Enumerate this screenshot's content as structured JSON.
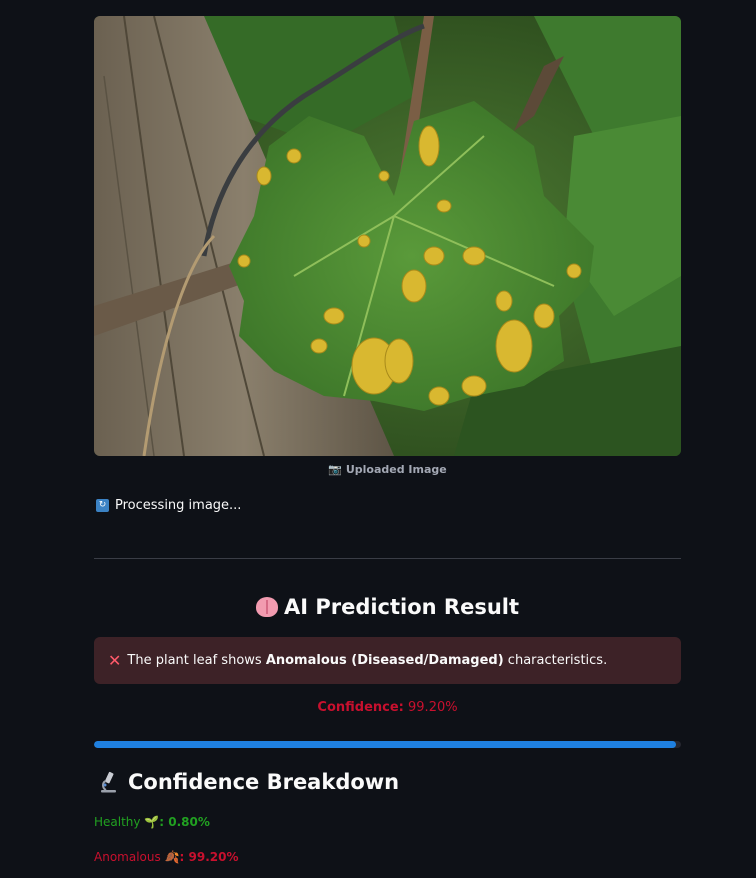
{
  "image": {
    "caption_icon": "camera-icon",
    "caption": "Uploaded Image"
  },
  "status": {
    "icon": "refresh-icon",
    "text": "Processing image..."
  },
  "result": {
    "heading_icon": "brain-icon",
    "heading": "AI Prediction Result",
    "alert_icon": "cross-mark-icon",
    "alert_prefix": "The plant leaf shows ",
    "alert_bold": "Anomalous (Diseased/Damaged)",
    "alert_suffix": " characteristics.",
    "alert_color": "#3d2227",
    "confidence_label": "Confidence:",
    "confidence_value": "99.20%",
    "progress_fraction": 0.992,
    "accent_color": "#1f80e0",
    "danger_color": "#c8102e"
  },
  "breakdown": {
    "heading_icon": "microscope-icon",
    "heading": "Confidence Breakdown",
    "healthy_label": "Healthy",
    "healthy_icon": "seedling-icon",
    "healthy_value": ": 0.80%",
    "healthy_color": "#21a121",
    "anomalous_label": "Anomalous",
    "anomalous_icon": "fallen-leaf-icon",
    "anomalous_value": ": 99.20%"
  }
}
